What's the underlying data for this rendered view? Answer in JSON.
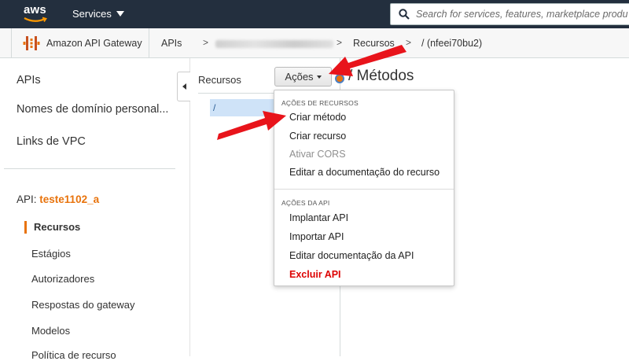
{
  "header": {
    "logo_text": "aws",
    "services_label": "Services",
    "search_placeholder": "Search for services, features, marketplace products"
  },
  "breadcrumb": {
    "service": "Amazon API Gateway",
    "items": [
      "APIs",
      "Recursos",
      "/ (nfeei70bu2)"
    ],
    "separator": ">"
  },
  "sidebar": {
    "items": [
      "APIs",
      "Nomes de domínio personal...",
      "Links de VPC"
    ],
    "api_prefix": "API:",
    "api_name": "teste1102_a",
    "sub_items": [
      "Recursos",
      "Estágios",
      "Autorizadores",
      "Respostas do gateway",
      "Modelos",
      "Política de recurso"
    ]
  },
  "resources": {
    "title": "Recursos",
    "root": "/"
  },
  "actions": {
    "button_label": "Ações"
  },
  "page": {
    "title": "/ Métodos"
  },
  "dropdown": {
    "resource_header": "AÇÕES DE RECURSOS",
    "resource_items": [
      "Criar método",
      "Criar recurso",
      "Ativar CORS",
      "Editar a documentação do recurso"
    ],
    "api_header": "AÇÕES DA API",
    "api_items": [
      "Implantar API",
      "Importar API",
      "Editar documentação da API",
      "Excluir API"
    ]
  },
  "colors": {
    "topbar": "#232f3e",
    "accent": "#e8730c",
    "danger": "#dd0000",
    "annotation_arrow": "#e8141b"
  }
}
